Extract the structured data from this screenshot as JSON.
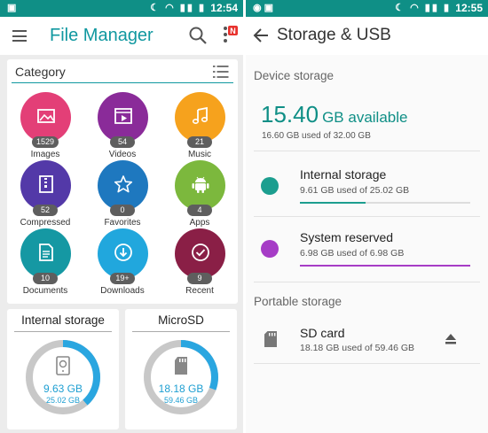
{
  "left": {
    "status_time": "12:54",
    "app_title": "File Manager",
    "notification_badge": "N",
    "category": {
      "title": "Category",
      "items": [
        {
          "label": "Images",
          "count": "1529",
          "color": "#e33f77",
          "icon": "image-icon"
        },
        {
          "label": "Videos",
          "count": "54",
          "color": "#8a2b99",
          "icon": "video-icon"
        },
        {
          "label": "Music",
          "count": "21",
          "color": "#f6a21d",
          "icon": "music-icon"
        },
        {
          "label": "Compressed",
          "count": "52",
          "color": "#5339a8",
          "icon": "zip-icon"
        },
        {
          "label": "Favorites",
          "count": "0",
          "color": "#1e78bf",
          "icon": "star-icon"
        },
        {
          "label": "Apps",
          "count": "4",
          "color": "#7cb83d",
          "icon": "android-icon"
        },
        {
          "label": "Documents",
          "count": "10",
          "color": "#1598a3",
          "icon": "document-icon"
        },
        {
          "label": "Downloads",
          "count": "19+",
          "color": "#21a7dd",
          "icon": "download-icon"
        },
        {
          "label": "Recent",
          "count": "9",
          "color": "#8a1f46",
          "icon": "recent-icon"
        }
      ]
    },
    "internal": {
      "title": "Internal storage",
      "used": "9.63 GB",
      "total": "25.02 GB",
      "fraction": 0.385
    },
    "microsd": {
      "title": "MicroSD",
      "used": "18.18 GB",
      "total": "59.46 GB",
      "fraction": 0.306
    }
  },
  "right": {
    "status_time": "12:55",
    "title": "Storage & USB",
    "device_section": "Device storage",
    "available_number": "15.40",
    "available_unit": "GB available",
    "used_summary": "16.60 GB used of 32.00 GB",
    "rows": [
      {
        "label": "Internal storage",
        "sub": "9.61 GB used of 25.02 GB",
        "color": "#1c9e8f",
        "fraction": 0.384
      },
      {
        "label": "System reserved",
        "sub": "6.98 GB used of 6.98 GB",
        "color": "#a63cc6",
        "fraction": 1.0
      }
    ],
    "portable_section": "Portable storage",
    "sd": {
      "label": "SD card",
      "sub": "18.18 GB used of 59.46 GB"
    }
  },
  "colors": {
    "teal": "#0f8f86",
    "ring_fill": "#2aa6e0",
    "ring_track": "#c8c8c8"
  }
}
